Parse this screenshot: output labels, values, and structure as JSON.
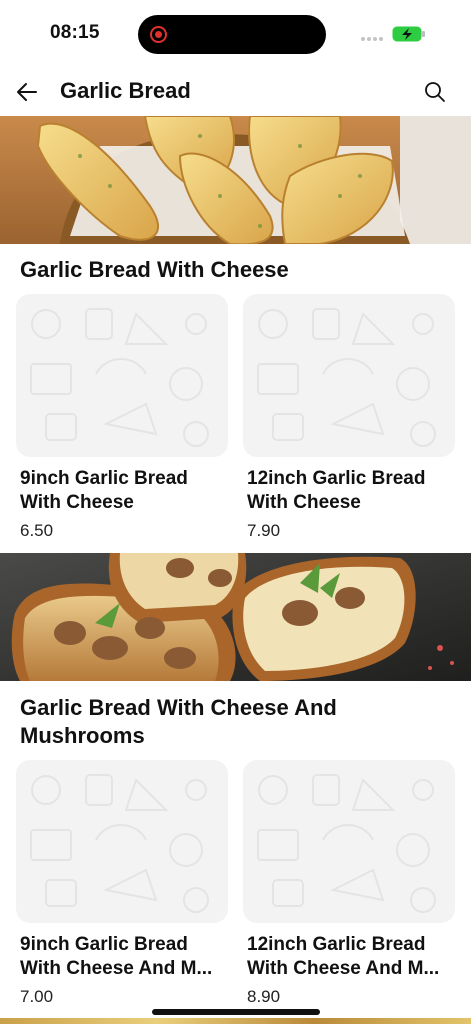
{
  "status_bar": {
    "time": "08:15"
  },
  "header": {
    "title": "Garlic Bread"
  },
  "sections": [
    {
      "title": "Garlic Bread With Cheese",
      "items": [
        {
          "name": "9inch Garlic Bread\nWith Cheese",
          "price": "6.50"
        },
        {
          "name": "12inch Garlic Bread\nWith Cheese",
          "price": "7.90"
        }
      ]
    },
    {
      "title": "Garlic Bread With Cheese And\nMushrooms",
      "items": [
        {
          "name": "9inch Garlic Bread\nWith Cheese And M...",
          "price": "7.00"
        },
        {
          "name": "12inch Garlic Bread\nWith Cheese And M...",
          "price": "8.90"
        }
      ]
    }
  ],
  "icons": {
    "back": "arrow-left-icon",
    "search": "search-icon",
    "battery": "battery-charging-icon",
    "placeholder": "food-pattern-placeholder"
  },
  "colors": {
    "accent_battery": "#2ecc40",
    "placeholder_bg": "#f3f3f3",
    "recording": "#e0312b"
  }
}
